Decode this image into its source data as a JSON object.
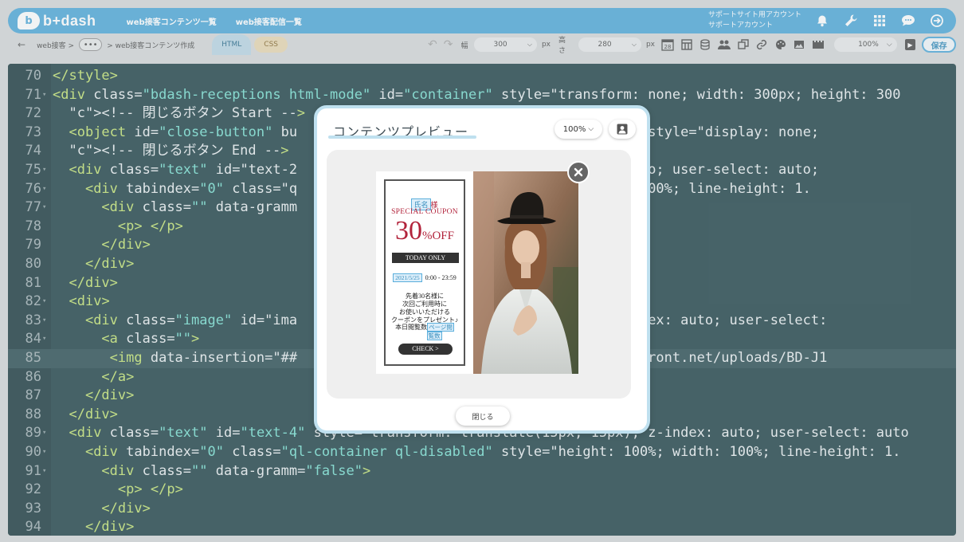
{
  "header": {
    "logo_text": "b+dash",
    "nav": [
      "web接客コンテンツ一覧",
      "web接客配信一覧"
    ],
    "account_line1": "サポートサイト用アカウント",
    "account_line2": "サポートアカウント",
    "icons": [
      "bell-icon",
      "wrench-icon",
      "grid-icon",
      "chat-icon",
      "logout-icon"
    ]
  },
  "toolbar": {
    "back": "←",
    "crumb1": "web接客 >",
    "dots": "•••",
    "crumb2": "> web接客コンテンツ作成",
    "tab_html": "HTML",
    "tab_css": "CSS",
    "width_label": "幅",
    "width_value": "300",
    "height_label": "高さ",
    "height_value": "280",
    "unit": "px",
    "calendar_day": "28",
    "zoom_value": "100%",
    "save": "保存"
  },
  "editor": {
    "active_line": 85,
    "lines": [
      {
        "n": "70",
        "fold": false,
        "code": "</style>"
      },
      {
        "n": "71",
        "fold": true,
        "code": "<div class=\"bdash-receptions html-mode\" id=\"container\" style=\"transform: none; width: 300px; height: 300"
      },
      {
        "n": "72",
        "fold": false,
        "code": "  <!-- 閉じるボタン Start -->"
      },
      {
        "n": "73",
        "fold": false,
        "code": "  <object id=\"close-button\" bu                             \"285\" y=\"-15\" style=\"display: none;"
      },
      {
        "n": "74",
        "fold": false,
        "code": "  <!-- 閉じるボタン End -->"
      },
      {
        "n": "75",
        "fold": true,
        "code": "  <div class=\"text\" id=\"text-2                             ; z-index: auto; user-select: auto;"
      },
      {
        "n": "76",
        "fold": true,
        "code": "    <div tabindex=\"0\" class=\"q                             100%; width: 100%; line-height: 1."
      },
      {
        "n": "77",
        "fold": true,
        "code": "      <div class=\"\" data-gramm"
      },
      {
        "n": "78",
        "fold": false,
        "code": "        <p> </p>"
      },
      {
        "n": "79",
        "fold": false,
        "code": "      </div>"
      },
      {
        "n": "80",
        "fold": false,
        "code": "    </div>"
      },
      {
        "n": "81",
        "fold": false,
        "code": "  </div>"
      },
      {
        "n": "82",
        "fold": true,
        "code": "  <div>"
      },
      {
        "n": "83",
        "fold": true,
        "code": "    <div class=\"image\" id=\"ima                              , 0px); z-index: auto; user-select:"
      },
      {
        "n": "84",
        "fold": true,
        "code": "      <a class=\"\">"
      },
      {
        "n": "85",
        "fold": false,
        "code": "       <img data-insertion=\"##                              bgaoof.cloudfront.net/uploads/BD-J1"
      },
      {
        "n": "86",
        "fold": false,
        "code": "      </a>"
      },
      {
        "n": "87",
        "fold": false,
        "code": "    </div>"
      },
      {
        "n": "88",
        "fold": false,
        "code": "  </div>"
      },
      {
        "n": "89",
        "fold": true,
        "code": "  <div class=\"text\" id=\"text-4\" style=\"transform: translate(15px, 15px); z-index: auto; user-select: auto"
      },
      {
        "n": "90",
        "fold": true,
        "code": "    <div tabindex=\"0\" class=\"ql-container ql-disabled\" style=\"height: 100%; width: 100%; line-height: 1."
      },
      {
        "n": "91",
        "fold": true,
        "code": "      <div class=\"\" data-gramm=\"false\">"
      },
      {
        "n": "92",
        "fold": false,
        "code": "        <p> </p>"
      },
      {
        "n": "93",
        "fold": false,
        "code": "      </div>"
      },
      {
        "n": "94",
        "fold": false,
        "code": "    </div>"
      }
    ]
  },
  "modal": {
    "title": "コンテンツプレビュー",
    "zoom": "100%",
    "close_label": "閉じる",
    "coupon": {
      "name_badge": "氏名",
      "sama": "様",
      "special": "SPECIAL COUPON",
      "amount": "30",
      "pct_off": "%OFF",
      "today_only": "TODAY ONLY",
      "date_chip": "2021/5/25",
      "time_range": "0:00 - 23:59",
      "text1": "先着30名様に",
      "text2": "次回ご利用時に",
      "text3": "お使いいただける",
      "text4": "クーポンをプレゼント♪",
      "pv_label": "本日閲覧数",
      "pv_chip1": "ページ閲",
      "pv_chip2": "覧数",
      "check": "CHECK   >"
    }
  }
}
